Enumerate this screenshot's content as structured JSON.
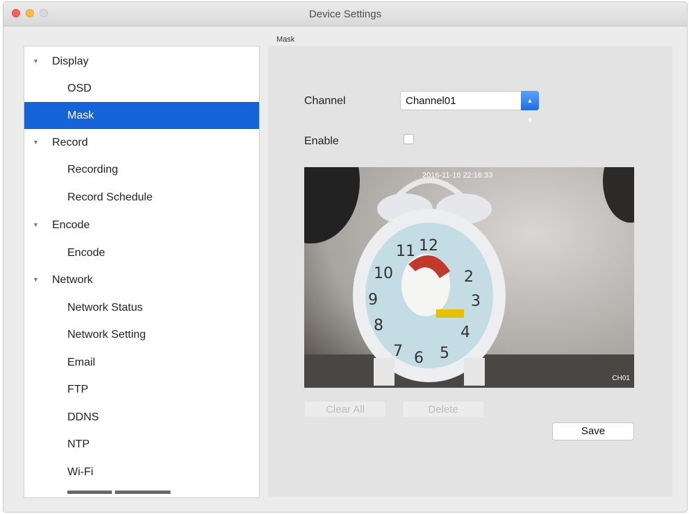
{
  "window": {
    "title": "Device Settings"
  },
  "section_label": "Mask",
  "sidebar": {
    "items": [
      {
        "label": "Display",
        "type": "parent",
        "expanded": true
      },
      {
        "label": "OSD",
        "type": "child"
      },
      {
        "label": "Mask",
        "type": "child",
        "selected": true
      },
      {
        "label": "Record",
        "type": "parent",
        "expanded": true
      },
      {
        "label": "Recording",
        "type": "child"
      },
      {
        "label": "Record Schedule",
        "type": "child"
      },
      {
        "label": "Encode",
        "type": "parent",
        "expanded": true
      },
      {
        "label": "Encode",
        "type": "child"
      },
      {
        "label": "Network",
        "type": "parent",
        "expanded": true
      },
      {
        "label": "Network Status",
        "type": "child"
      },
      {
        "label": "Network Setting",
        "type": "child"
      },
      {
        "label": "Email",
        "type": "child"
      },
      {
        "label": "FTP",
        "type": "child"
      },
      {
        "label": "DDNS",
        "type": "child"
      },
      {
        "label": "NTP",
        "type": "child"
      },
      {
        "label": "Wi-Fi",
        "type": "child"
      }
    ]
  },
  "form": {
    "channel_label": "Channel",
    "channel_value": "Channel01",
    "enable_label": "Enable",
    "enable_checked": false
  },
  "preview": {
    "osd_time": "2016-11-16 22:16:33",
    "osd_name": "CH01"
  },
  "buttons": {
    "clear_all": "Clear All",
    "delete": "Delete",
    "save": "Save"
  },
  "colors": {
    "selection": "#1463d8",
    "select_button": "#2a7cea"
  }
}
